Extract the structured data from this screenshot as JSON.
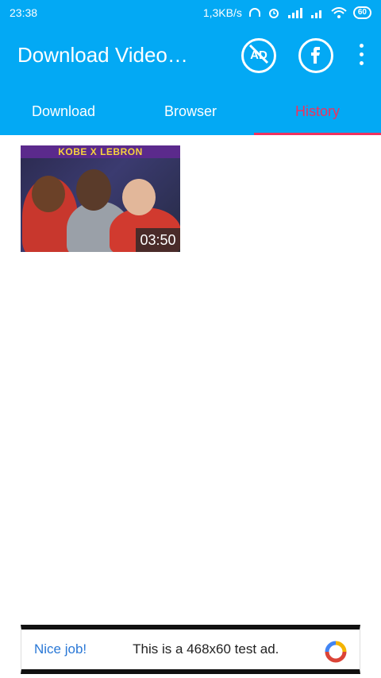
{
  "status_bar": {
    "time": "23:38",
    "net_speed": "1,3KB/s",
    "battery": "60"
  },
  "app_bar": {
    "title": "Download Video…",
    "icons": [
      "no-ads-icon",
      "facebook-icon",
      "more-vert-icon"
    ]
  },
  "tabs": [
    {
      "label": "Download"
    },
    {
      "label": "Browser"
    },
    {
      "label": "History"
    }
  ],
  "active_tab": "History",
  "history": {
    "items": [
      {
        "banner": "KOBE X LEBRON",
        "duration": "03:50"
      }
    ]
  },
  "ad": {
    "lead": "Nice job!",
    "text": "This is a 468x60 test ad."
  },
  "colors": {
    "primary": "#03a9f4",
    "accent": "#f0325e"
  }
}
